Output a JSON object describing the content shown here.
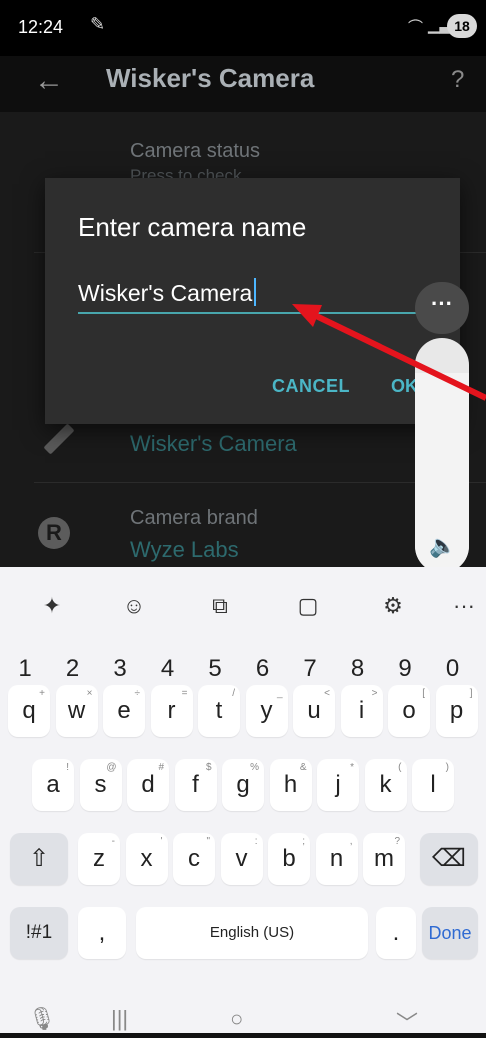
{
  "status": {
    "time": "12:24",
    "battery": "18"
  },
  "appbar": {
    "title": "Wisker's Camera",
    "back_icon": "arrow-left-icon",
    "help": "?"
  },
  "settings": {
    "status_title": "Camera status",
    "status_value": "Press to check",
    "name_value": "Wisker's Camera",
    "brand_title": "Camera brand",
    "brand_value": "Wyze Labs"
  },
  "dialog": {
    "title": "Enter camera name",
    "input_value": "Wisker's Camera",
    "cancel_label": "CANCEL",
    "ok_label": "OK"
  },
  "volume": {
    "menu": "···",
    "level_fraction": 0.85
  },
  "keyboard": {
    "toolbar_icons": [
      "sparkle-icon",
      "emoji-icon",
      "translate-icon",
      "clipboard-icon",
      "settings-icon",
      "more-icon"
    ],
    "more_label": "···",
    "numbers": [
      "1",
      "2",
      "3",
      "4",
      "5",
      "6",
      "7",
      "8",
      "9",
      "0"
    ],
    "row1": [
      "q",
      "w",
      "e",
      "r",
      "t",
      "y",
      "u",
      "i",
      "o",
      "p"
    ],
    "row1_hints": [
      "+",
      "×",
      "÷",
      "=",
      "/",
      "_",
      "<",
      ">",
      "[",
      "]"
    ],
    "row2": [
      "a",
      "s",
      "d",
      "f",
      "g",
      "h",
      "j",
      "k",
      "l"
    ],
    "row2_hints": [
      "!",
      "@",
      "#",
      "$",
      "%",
      "&",
      "*",
      "(",
      ")"
    ],
    "row3": [
      "z",
      "x",
      "c",
      "v",
      "b",
      "n",
      "m"
    ],
    "row3_hints": [
      "-",
      "'",
      "\"",
      ":",
      ";",
      ",",
      "?"
    ],
    "symbols_label": "!#1",
    "comma_label": ",",
    "space_label": "English (US)",
    "period_label": ".",
    "done_label": "Done"
  },
  "navbar": {
    "mic": "mic-icon",
    "recents": "|||",
    "home": "○",
    "back": "﹀"
  },
  "colors": {
    "accent": "#4bb6c6",
    "arrow": "#e4141d",
    "done": "#2f6ad2"
  }
}
